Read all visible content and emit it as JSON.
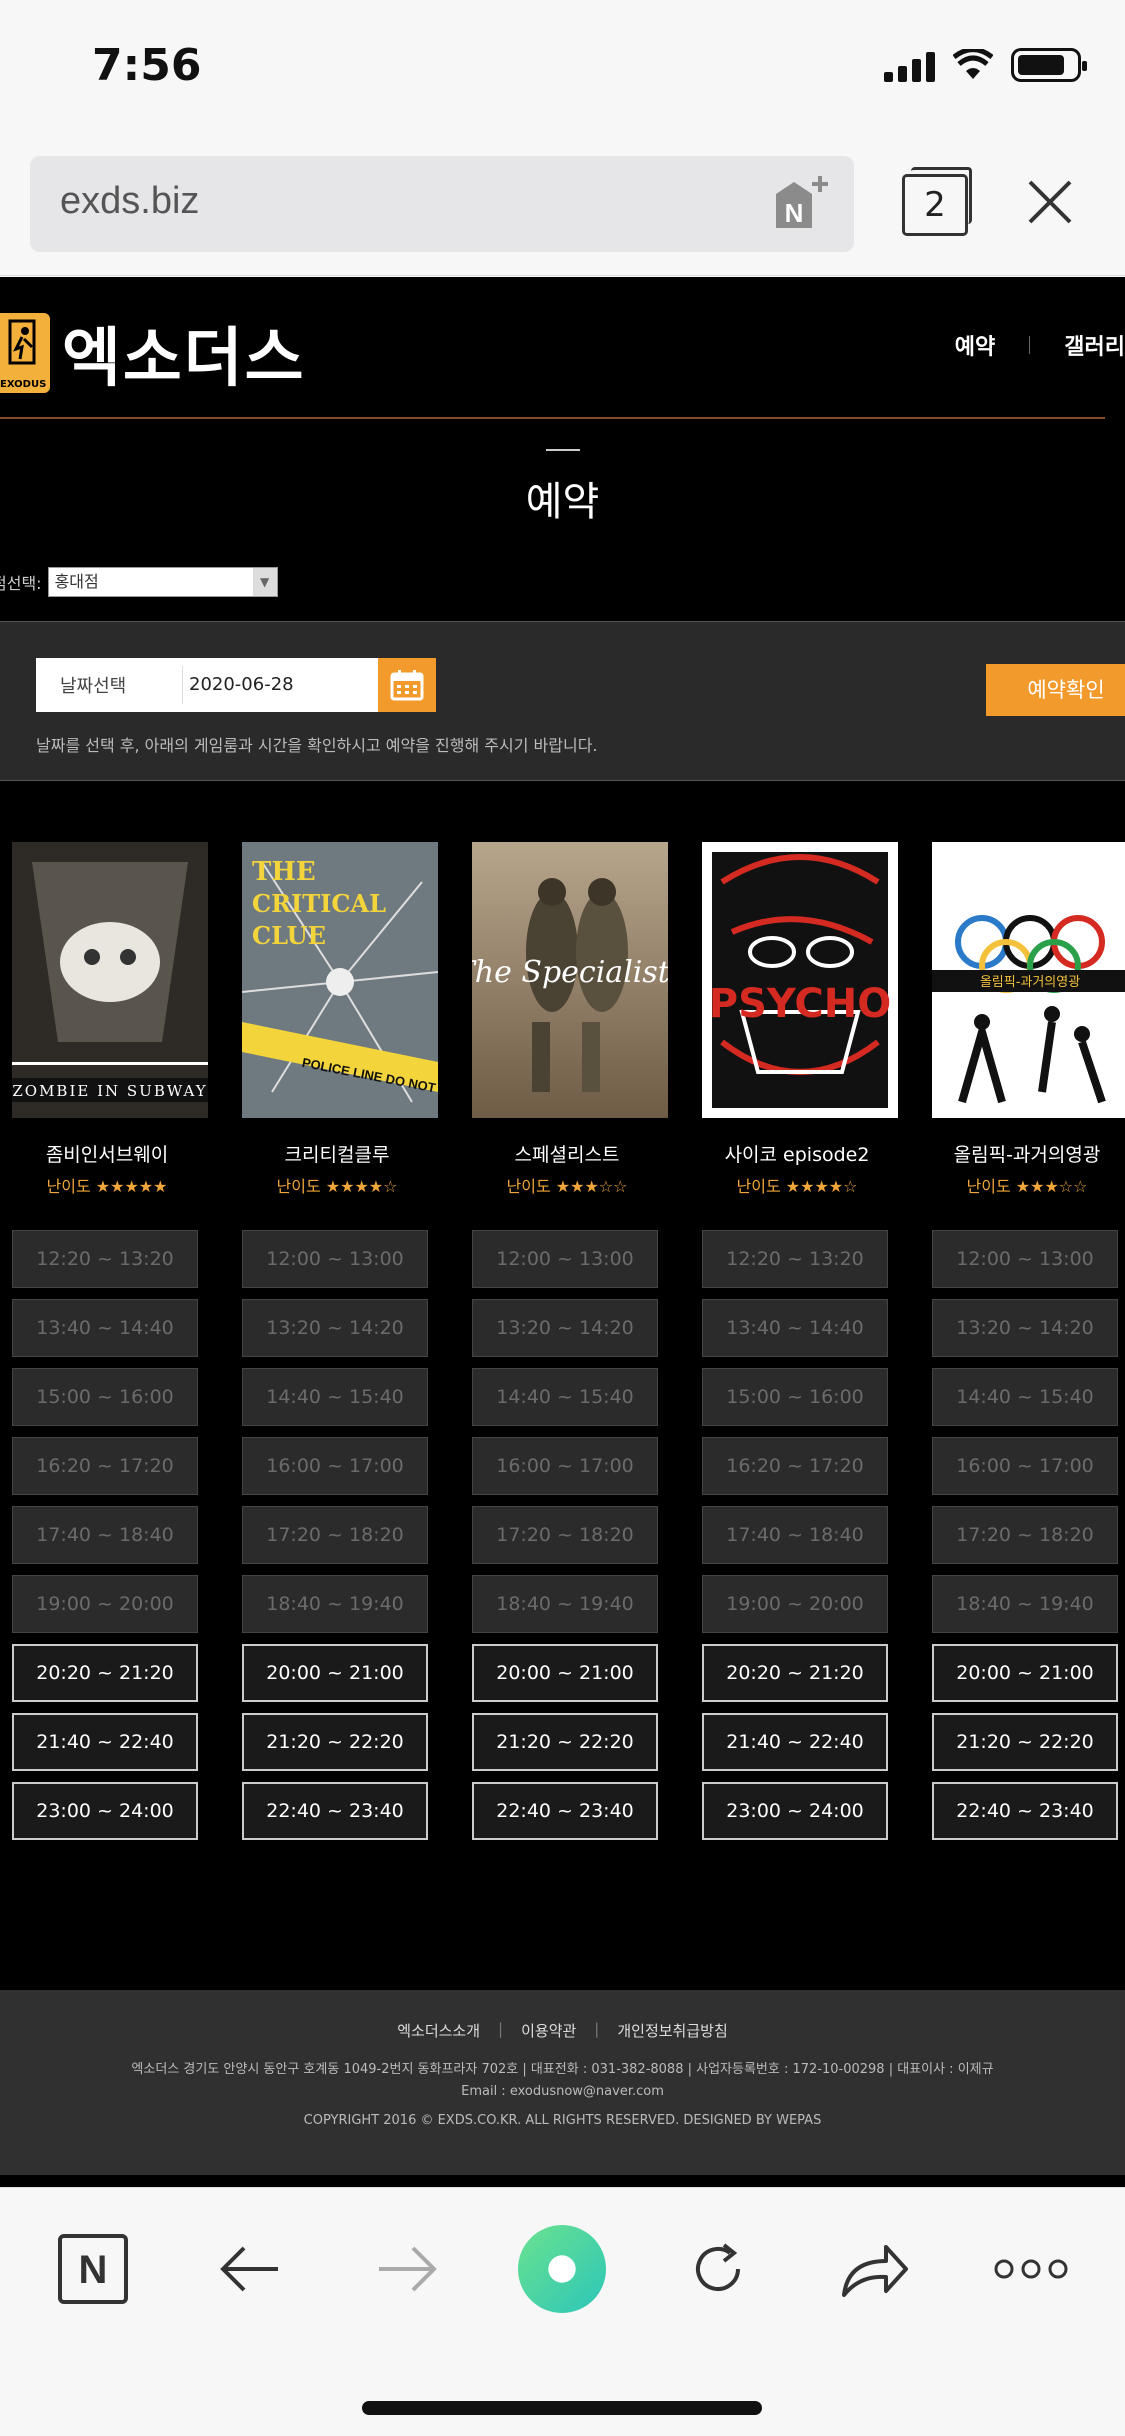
{
  "status": {
    "time": "7:56"
  },
  "browser": {
    "url": "exds.biz",
    "tab_count": "2"
  },
  "site": {
    "logo_text": "엑소더스",
    "logo_mark_text": "EXODUS",
    "nav": [
      "예약",
      "갤러리"
    ],
    "page_title": "예약",
    "branch_label": "점선택:",
    "branch_value": "홍대점",
    "date_label": "날짜선택",
    "date_value": "2020-06-28",
    "confirm_label": "예약확인",
    "date_hint": "날짜를 선택 후, 아래의 게임룸과 시간을 확인하시고 예약을 진행해 주시기 바랍니다."
  },
  "themes": [
    {
      "name": "좀비인서브웨이",
      "level": "난이도 ★★★★★",
      "poster_caption": "ZOMBIE IN SUBWAY",
      "slots": [
        {
          "time": "12:20 ~ 13:20",
          "open": false
        },
        {
          "time": "13:40 ~ 14:40",
          "open": false
        },
        {
          "time": "15:00 ~ 16:00",
          "open": false
        },
        {
          "time": "16:20 ~ 17:20",
          "open": false
        },
        {
          "time": "17:40 ~ 18:40",
          "open": false
        },
        {
          "time": "19:00 ~ 20:00",
          "open": false
        },
        {
          "time": "20:20 ~ 21:20",
          "open": true
        },
        {
          "time": "21:40 ~ 22:40",
          "open": true
        },
        {
          "time": "23:00 ~ 24:00",
          "open": true
        }
      ]
    },
    {
      "name": "크리티컬클루",
      "level": "난이도 ★★★★☆",
      "poster_caption": "THE CRITICAL CLUE",
      "slots": [
        {
          "time": "12:00 ~ 13:00",
          "open": false
        },
        {
          "time": "13:20 ~ 14:20",
          "open": false
        },
        {
          "time": "14:40 ~ 15:40",
          "open": false
        },
        {
          "time": "16:00 ~ 17:00",
          "open": false
        },
        {
          "time": "17:20 ~ 18:20",
          "open": false
        },
        {
          "time": "18:40 ~ 19:40",
          "open": false
        },
        {
          "time": "20:00 ~ 21:00",
          "open": true
        },
        {
          "time": "21:20 ~ 22:20",
          "open": true
        },
        {
          "time": "22:40 ~ 23:40",
          "open": true
        }
      ]
    },
    {
      "name": "스페셜리스트",
      "level": "난이도 ★★★☆☆",
      "poster_caption": "The Specialists",
      "slots": [
        {
          "time": "12:00 ~ 13:00",
          "open": false
        },
        {
          "time": "13:20 ~ 14:20",
          "open": false
        },
        {
          "time": "14:40 ~ 15:40",
          "open": false
        },
        {
          "time": "16:00 ~ 17:00",
          "open": false
        },
        {
          "time": "17:20 ~ 18:20",
          "open": false
        },
        {
          "time": "18:40 ~ 19:40",
          "open": false
        },
        {
          "time": "20:00 ~ 21:00",
          "open": true
        },
        {
          "time": "21:20 ~ 22:20",
          "open": true
        },
        {
          "time": "22:40 ~ 23:40",
          "open": true
        }
      ]
    },
    {
      "name": "사이코 episode2",
      "level": "난이도 ★★★★☆",
      "poster_caption": "PSYCHO",
      "slots": [
        {
          "time": "12:20 ~ 13:20",
          "open": false
        },
        {
          "time": "13:40 ~ 14:40",
          "open": false
        },
        {
          "time": "15:00 ~ 16:00",
          "open": false
        },
        {
          "time": "16:20 ~ 17:20",
          "open": false
        },
        {
          "time": "17:40 ~ 18:40",
          "open": false
        },
        {
          "time": "19:00 ~ 20:00",
          "open": false
        },
        {
          "time": "20:20 ~ 21:20",
          "open": true
        },
        {
          "time": "21:40 ~ 22:40",
          "open": true
        },
        {
          "time": "23:00 ~ 24:00",
          "open": true
        }
      ]
    },
    {
      "name": "올림픽-과거의영광",
      "level": "난이도 ★★★☆☆",
      "poster_caption": "올림픽-과거의영광",
      "slots": [
        {
          "time": "12:00 ~ 13:00",
          "open": false
        },
        {
          "time": "13:20 ~ 14:20",
          "open": false
        },
        {
          "time": "14:40 ~ 15:40",
          "open": false
        },
        {
          "time": "16:00 ~ 17:00",
          "open": false
        },
        {
          "time": "17:20 ~ 18:20",
          "open": false
        },
        {
          "time": "18:40 ~ 19:40",
          "open": false
        },
        {
          "time": "20:00 ~ 21:00",
          "open": true
        },
        {
          "time": "21:20 ~ 22:20",
          "open": true
        },
        {
          "time": "22:40 ~ 23:40",
          "open": true
        }
      ]
    }
  ],
  "footer": {
    "links": [
      "엑소더스소개",
      "이용약관",
      "개인정보취급방침"
    ],
    "info": "엑소더스   경기도 안양시 동안구 호계동 1049-2번지 동화프라자 702호   |   대표전화 : 031-382-8088   |   사업자등록번호 : 172-10-00298   |   대표이사 : 이제규",
    "email": "Email : exodusnow@naver.com",
    "copyright": "COPYRIGHT 2016 © EXDS.CO.KR.  ALL RIGHTS RESERVED. DESIGNED BY WEPAS"
  },
  "colors": {
    "accent": "#f39a2d",
    "level": "#f0a63a",
    "background": "#000000"
  }
}
